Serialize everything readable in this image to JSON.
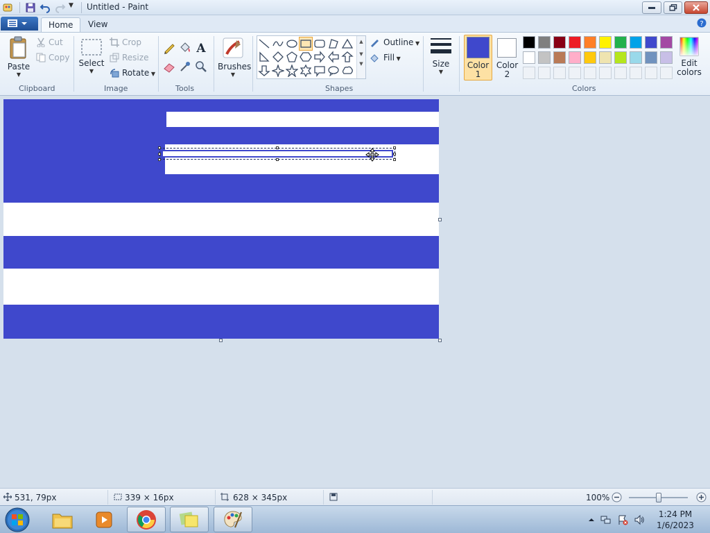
{
  "window": {
    "title": "Untitled - Paint"
  },
  "tabs": {
    "home": "Home",
    "view": "View"
  },
  "clipboard": {
    "paste": "Paste",
    "cut": "Cut",
    "copy": "Copy",
    "group": "Clipboard"
  },
  "image": {
    "select": "Select",
    "crop": "Crop",
    "resize": "Resize",
    "rotate": "Rotate",
    "group": "Image"
  },
  "tools": {
    "group": "Tools"
  },
  "brushes": {
    "label": "Brushes"
  },
  "shapes": {
    "outline": "Outline",
    "fill": "Fill",
    "group": "Shapes"
  },
  "size": {
    "label": "Size"
  },
  "colors": {
    "color1_line1": "Color",
    "color1_line2": "1",
    "color2_line1": "Color",
    "color2_line2": "2",
    "edit_line1": "Edit",
    "edit_line2": "colors",
    "group": "Colors",
    "color1_value": "#3f48cc",
    "color2_value": "#ffffff",
    "palette_row1": [
      "#000000",
      "#7f7f7f",
      "#880015",
      "#ed1c24",
      "#ff7f27",
      "#fff200",
      "#22b14c",
      "#00a2e8",
      "#3f48cc",
      "#a349a4"
    ],
    "palette_row2": [
      "#ffffff",
      "#c3c3c3",
      "#b97a57",
      "#ffaec9",
      "#ffc90e",
      "#efe4b0",
      "#b5e61d",
      "#99d9ea",
      "#7092be",
      "#c8bfe7"
    ]
  },
  "status": {
    "cursor_pos": "531, 79px",
    "selection_size": "339 × 16px",
    "canvas_size": "628 × 345px",
    "zoom": "100%"
  },
  "clock": {
    "time": "1:24 PM",
    "date": "1/6/2023"
  }
}
